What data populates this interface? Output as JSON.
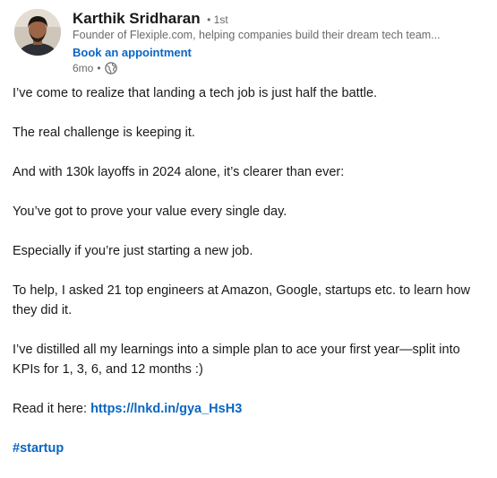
{
  "post": {
    "author": {
      "name": "Karthik Sridharan",
      "connection_degree": "1st",
      "headline": "Founder of Flexiple.com, helping companies build their dream tech team...",
      "book_label": "Book an appointment",
      "time_ago": "6mo",
      "visibility_icon": "globe-icon"
    },
    "body": {
      "p1": "I’ve come to realize that landing a tech job is just half the battle.",
      "p2": "The real challenge is keeping it.",
      "p3": "And with 130k layoffs in 2024 alone, it’s clearer than ever:",
      "p4": "You’ve got to prove your value every single day.",
      "p5": "Especially if you’re just starting a new job.",
      "p6": "To help, I asked 21 top engineers at Amazon, Google, startups etc. to learn how they did it.",
      "p7": "I’ve distilled all my learnings into a simple plan to ace your first year—split into KPIs for 1, 3, 6, and 12 months :)",
      "p8_prefix": "Read it here: ",
      "p8_link": "https://lnkd.in/gya_HsH3",
      "hashtag": "#startup"
    },
    "colors": {
      "link": "#0a66c2",
      "text": "#000000e6",
      "secondary_text": "#00000099"
    }
  }
}
